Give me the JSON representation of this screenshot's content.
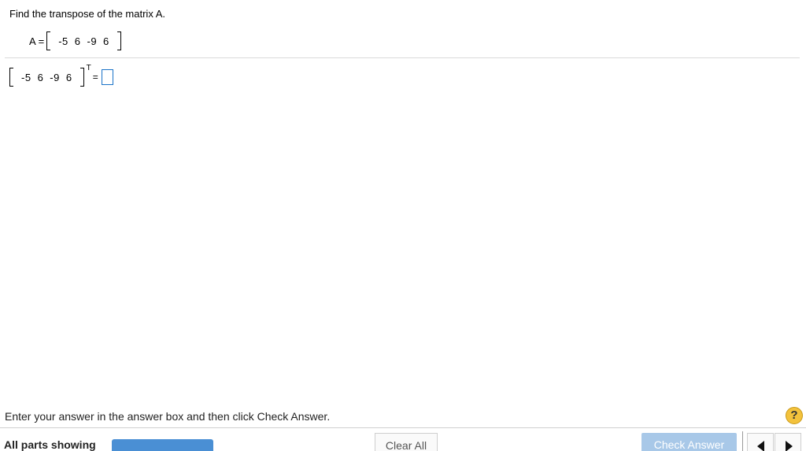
{
  "question": {
    "text": "Find the transpose of the matrix A."
  },
  "matrix_a": {
    "label": "A",
    "equals": "=",
    "entries": [
      "-5",
      "6",
      "-9",
      "6"
    ]
  },
  "transpose_row": {
    "entries": [
      "-5",
      "6",
      "-9",
      "6"
    ],
    "superscript": "T",
    "equals": "="
  },
  "footer": {
    "instruction": "Enter your answer in the answer box and then click Check Answer.",
    "help_symbol": "?",
    "parts_label": "All parts showing",
    "clear_all_label": "Clear All",
    "check_answer_label": "Check Answer"
  },
  "colors": {
    "accent": "#4a8fd4",
    "check_button": "#a8c8e8",
    "answer_box_border": "#1a73c8",
    "help_icon": "#f3c23c"
  },
  "icons": {
    "help": "question-mark-icon",
    "prev": "triangle-left-icon",
    "next": "triangle-right-icon"
  }
}
